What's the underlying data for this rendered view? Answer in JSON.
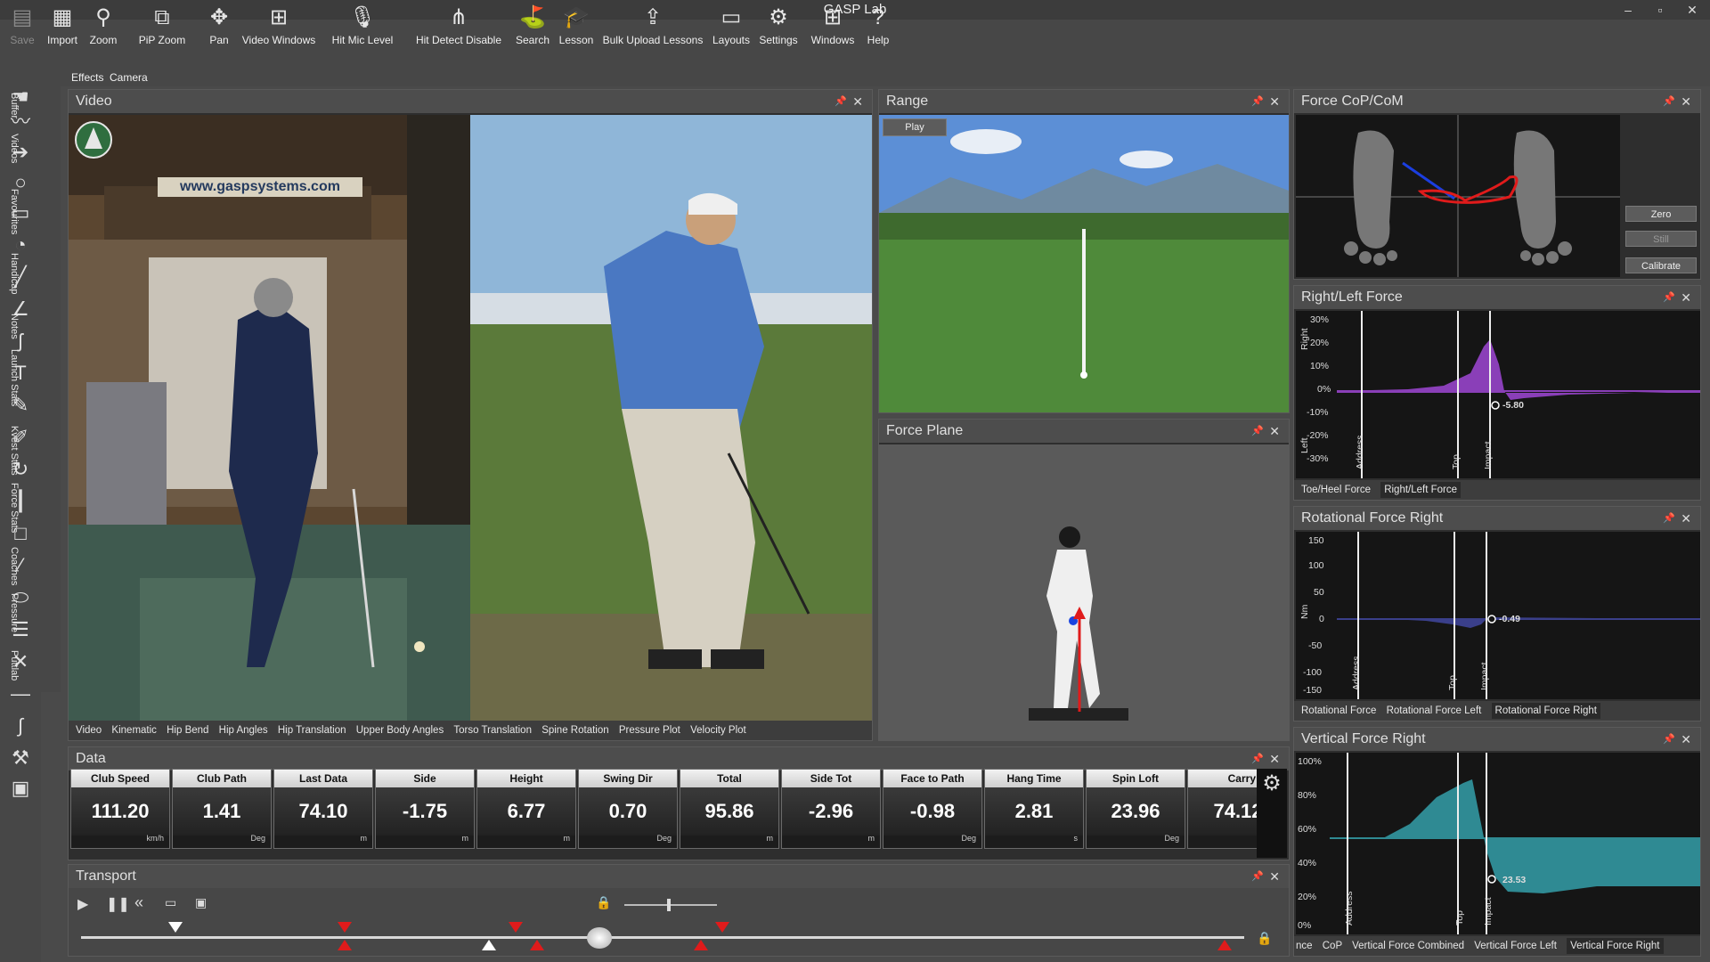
{
  "app": {
    "title": "GASP Lab"
  },
  "toolbar": {
    "items": [
      {
        "label": "Save",
        "icon": "save-icon"
      },
      {
        "label": "Import",
        "icon": "import-icon"
      },
      {
        "label": "Zoom",
        "icon": "zoom-icon"
      },
      {
        "label": "PiP Zoom",
        "icon": "pip-zoom-icon"
      },
      {
        "label": "Pan",
        "icon": "pan-icon"
      },
      {
        "label": "Video Windows",
        "icon": "video-windows-icon"
      },
      {
        "label": "Hit Mic Level",
        "icon": "mic-icon"
      },
      {
        "label": "Hit Detect Disable",
        "icon": "hit-detect-icon"
      },
      {
        "label": "Search",
        "icon": "search-icon"
      },
      {
        "label": "Lesson",
        "icon": "lesson-icon"
      },
      {
        "label": "Bulk Upload Lessons",
        "icon": "bulk-upload-icon"
      },
      {
        "label": "Layouts",
        "icon": "layouts-icon"
      },
      {
        "label": "Settings",
        "icon": "settings-icon"
      },
      {
        "label": "Windows",
        "icon": "windows-icon"
      },
      {
        "label": "Help",
        "icon": "help-icon"
      }
    ],
    "sub_effects": "Effects",
    "sub_camera": "Camera"
  },
  "side_tabs": [
    "Buffer",
    "Videos",
    "Favourites",
    "Handicap",
    "Notes",
    "Launch Stats",
    "Kvest Stats",
    "Force Stats",
    "Coaches",
    "Pressure",
    "Puttlab"
  ],
  "video_panel": {
    "title": "Video",
    "website_text": "www.gaspsystems.com",
    "tabs": [
      "Video",
      "Kinematic",
      "Hip Bend",
      "Hip Angles",
      "Hip Translation",
      "Upper Body Angles",
      "Torso Translation",
      "Spine Rotation",
      "Pressure Plot",
      "Velocity Plot"
    ]
  },
  "range_panel": {
    "title": "Range",
    "play_label": "Play"
  },
  "force_plane_panel": {
    "title": "Force Plane"
  },
  "cop_panel": {
    "title": "Force CoP/CoM",
    "buttons": [
      "Zero",
      "Still",
      "Calibrate"
    ]
  },
  "rl_force": {
    "title": "Right/Left Force",
    "yticks": [
      "30%",
      "20%",
      "10%",
      "0%",
      "-10%",
      "-20%",
      "-30%"
    ],
    "side_right": "Right",
    "side_left": "Left",
    "markers": [
      "Address",
      "Top",
      "Impact"
    ],
    "readout": "-5.80",
    "tabs": [
      "Toe/Heel Force",
      "Right/Left Force"
    ],
    "color": "#8a3fb8"
  },
  "rot_force": {
    "title": "Rotational Force Right",
    "yticks": [
      "150",
      "100",
      "50",
      "0",
      "-50",
      "-100",
      "-150"
    ],
    "unit": "Nm",
    "markers": [
      "Address",
      "Top",
      "Impact"
    ],
    "readout": "-0.49",
    "tabs": [
      "Rotational Force",
      "Rotational Force Left",
      "Rotational Force Right"
    ],
    "color": "#3a3f8a"
  },
  "vert_force": {
    "title": "Vertical Force Right",
    "yticks": [
      "100%",
      "80%",
      "60%",
      "40%",
      "20%",
      "0%"
    ],
    "markers": [
      "Address",
      "Top",
      "Impact"
    ],
    "readout": "23.53",
    "tabs": [
      "nce",
      "CoP",
      "Vertical Force Combined",
      "Vertical Force Left",
      "Vertical Force Right"
    ],
    "color": "#2f8a93"
  },
  "data_panel": {
    "title": "Data",
    "cells": [
      {
        "label": "Club Speed",
        "value": "111.20",
        "unit": "km/h"
      },
      {
        "label": "Club Path",
        "value": "1.41",
        "unit": "Deg"
      },
      {
        "label": "Last Data",
        "value": "74.10",
        "unit": "m"
      },
      {
        "label": "Side",
        "value": "-1.75",
        "unit": "m"
      },
      {
        "label": "Height",
        "value": "6.77",
        "unit": "m"
      },
      {
        "label": "Swing Dir",
        "value": "0.70",
        "unit": "Deg"
      },
      {
        "label": "Total",
        "value": "95.86",
        "unit": "m"
      },
      {
        "label": "Side Tot",
        "value": "-2.96",
        "unit": "m"
      },
      {
        "label": "Face to Path",
        "value": "-0.98",
        "unit": "Deg"
      },
      {
        "label": "Hang Time",
        "value": "2.81",
        "unit": "s"
      },
      {
        "label": "Spin Loft",
        "value": "23.96",
        "unit": "Deg"
      },
      {
        "label": "Carry",
        "value": "74.12",
        "unit": ""
      }
    ]
  },
  "transport_panel": {
    "title": "Transport"
  }
}
